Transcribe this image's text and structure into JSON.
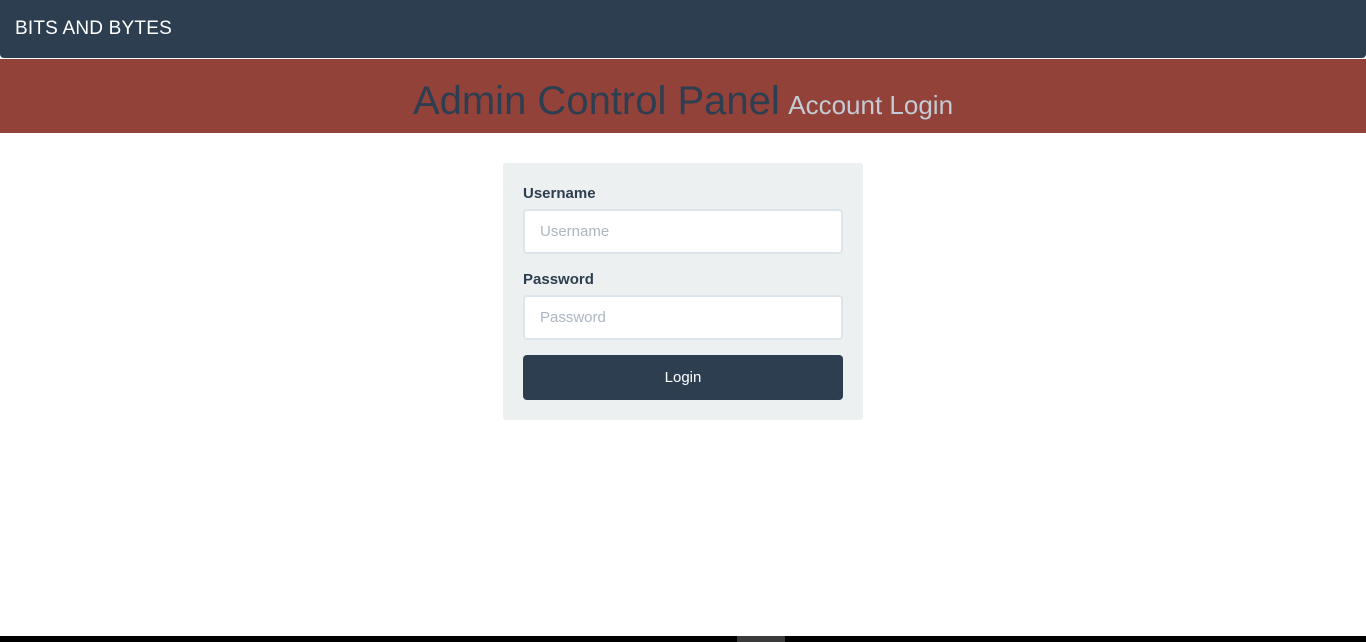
{
  "navbar": {
    "brand": "BITS AND BYTES"
  },
  "header": {
    "title": "Admin Control Panel",
    "subtitle": "Account Login"
  },
  "login_form": {
    "username_label": "Username",
    "username_placeholder": "Username",
    "username_value": "",
    "password_label": "Password",
    "password_placeholder": "Password",
    "password_value": "",
    "submit_label": "Login"
  },
  "colors": {
    "navbar_bg": "#2c3e50",
    "header_bg": "#93423a",
    "card_bg": "#ecf0f1",
    "button_bg": "#2c3e50",
    "subtitle_text": "#c3ccd4"
  }
}
